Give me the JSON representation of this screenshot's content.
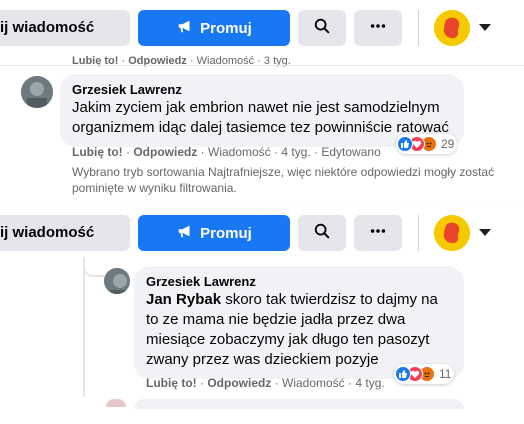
{
  "topbar": {
    "messages_label": "ij wiadomość",
    "promote_label": "Promuj",
    "search_icon": "search-icon",
    "more_icon": "more-dots-icon",
    "page_avatar": "page-avatar",
    "accent": "#1877f2"
  },
  "section1": {
    "cut_actions": {
      "like": "Lubię to!",
      "reply": "Odpowiedz",
      "meta": "· Wiadomość · 3 tyg."
    },
    "comment": {
      "author": "Grzesiek Lawrenz",
      "text": "Jakim zyciem jak embrion nawet nie jest samodzielnym organizmem idąc dalej tasiemce tez powinniście ratować",
      "like": "Lubię to!",
      "reply": "Odpowiedz",
      "meta": "· Wiadomość · 4 tyg. · Edytowano",
      "reaction_count": "29"
    },
    "notice": "Wybrano tryb sortowania Najtrafniejsze, więc niektóre odpowiedzi mogły zostać pominięte w wyniku filtrowania."
  },
  "section2": {
    "reply": {
      "author": "Grzesiek Lawrenz",
      "mention": "Jan Rybak",
      "text": " skoro tak twierdzisz to dajmy na to ze mama nie będzie jadła przez dwa miesiące zobaczymy jak długo ten pasozyt zwany przez was dzieckiem pozyje",
      "like": "Lubię to!",
      "reply": "Odpowiedz",
      "meta": "· Wiadomość · 4 tyg.",
      "reaction_count": "11"
    }
  }
}
